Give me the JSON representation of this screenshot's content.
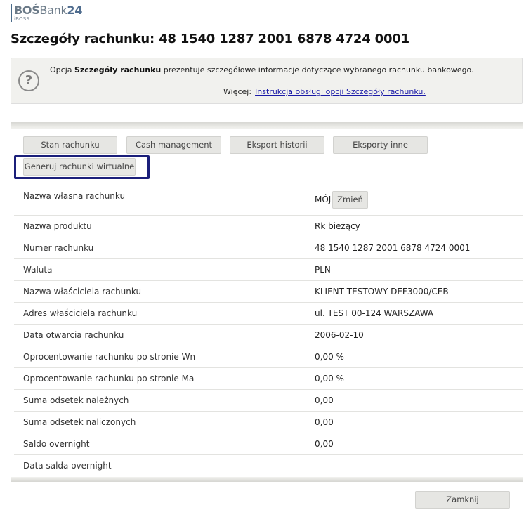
{
  "logo": {
    "bos": "BOŚ",
    "bank": "Bank",
    "num": "24",
    "sub": "iBOSS"
  },
  "page": {
    "title": "Szczegóły rachunku: 48 1540 1287 2001 6878 4724 0001"
  },
  "info": {
    "prefix": "Opcja ",
    "bold": "Szczegóły rachunku",
    "suffix": " prezentuje szczegółowe informacje dotyczące wybranego rachunku bankowego.",
    "more_label": "Więcej:",
    "link": "Instrukcja obsługi opcji Szczegóły rachunku.",
    "icon_glyph": "?"
  },
  "tabs": [
    {
      "label": "Stan rachunku"
    },
    {
      "label": "Cash management"
    },
    {
      "label": "Eksport historii"
    },
    {
      "label": "Eksporty inne"
    },
    {
      "label": "Generuj rachunki wirtualne"
    }
  ],
  "rows": [
    {
      "label": "Nazwa własna rachunku",
      "value": "MÓJ"
    },
    {
      "label": "Nazwa produktu",
      "value": "Rk bieżący"
    },
    {
      "label": "Numer rachunku",
      "value": "48 1540 1287 2001 6878 4724 0001"
    },
    {
      "label": "Waluta",
      "value": "PLN"
    },
    {
      "label": "Nazwa właściciela rachunku",
      "value": "KLIENT TESTOWY DEF3000/CEB"
    },
    {
      "label": "Adres właściciela rachunku",
      "value": "ul. TEST 00-124 WARSZAWA"
    },
    {
      "label": "Data otwarcia rachunku",
      "value": "2006-02-10"
    },
    {
      "label": "Oprocentowanie rachunku po stronie Wn",
      "value": "0,00 %"
    },
    {
      "label": "Oprocentowanie rachunku po stronie Ma",
      "value": "0,00 %"
    },
    {
      "label": "Suma odsetek należnych",
      "value": "0,00"
    },
    {
      "label": "Suma odsetek naliczonych",
      "value": "0,00"
    },
    {
      "label": "Saldo overnight",
      "value": "0,00"
    },
    {
      "label": "Data salda overnight",
      "value": ""
    }
  ],
  "actions": {
    "change": "Zmień",
    "close": "Zamknij"
  },
  "colors": {
    "highlight": "#1b1f7a",
    "link": "#1a1aa8",
    "info_bg": "#f1f1ee",
    "button_bg": "#e6e6e3"
  }
}
